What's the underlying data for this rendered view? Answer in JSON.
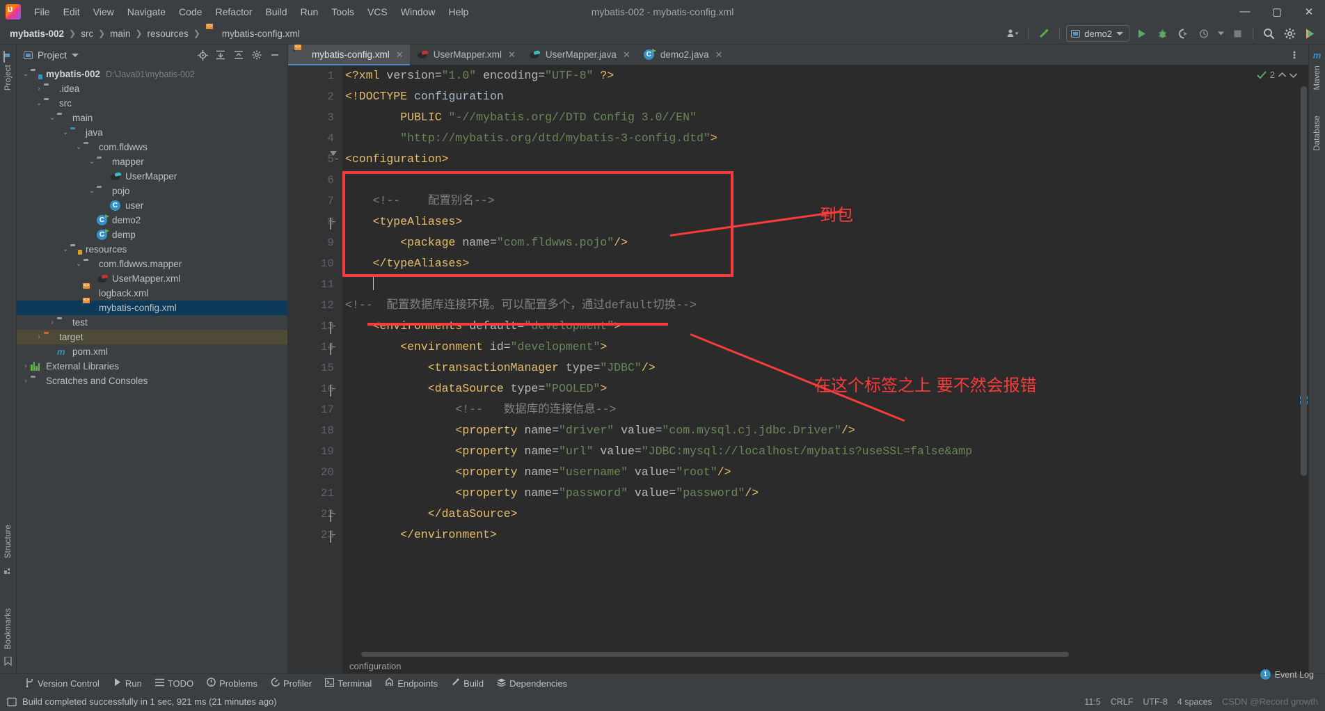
{
  "window": {
    "title": "mybatis-002 - mybatis-config.xml",
    "minimize": "—",
    "maximize": "▢",
    "close": "✕"
  },
  "menu": [
    "File",
    "Edit",
    "View",
    "Navigate",
    "Code",
    "Refactor",
    "Build",
    "Run",
    "Tools",
    "VCS",
    "Window",
    "Help"
  ],
  "breadcrumb": [
    "mybatis-002",
    "src",
    "main",
    "resources",
    "mybatis-config.xml"
  ],
  "toolbar": {
    "run_config": "demo2",
    "icons": [
      "person-dropdown-icon",
      "build-hammer-icon",
      "run-icon",
      "debug-icon",
      "run-with-coverage-icon",
      "profiler-icon",
      "stop-icon",
      "search-everywhere-icon",
      "settings-gear-icon",
      "ide-assistant-icon"
    ]
  },
  "project_panel": {
    "title": "Project",
    "header_icons": [
      "locate-icon",
      "expand-all-icon",
      "collapse-all-icon",
      "settings-gear-icon",
      "hide-icon"
    ],
    "tree": [
      {
        "label": "mybatis-002",
        "path": "D:\\Java01\\mybatis-002",
        "indent": 0,
        "arrow": "v",
        "icon": "module-folder-icon",
        "bold": true
      },
      {
        "label": ".idea",
        "path": "",
        "indent": 1,
        "arrow": ">",
        "icon": "folder-icon",
        "bold": false
      },
      {
        "label": "src",
        "path": "",
        "indent": 1,
        "arrow": "v",
        "icon": "folder-icon",
        "bold": false
      },
      {
        "label": "main",
        "path": "",
        "indent": 2,
        "arrow": "v",
        "icon": "folder-icon",
        "bold": false
      },
      {
        "label": "java",
        "path": "",
        "indent": 3,
        "arrow": "v",
        "icon": "source-folder-icon",
        "bold": false
      },
      {
        "label": "com.fldwws",
        "path": "",
        "indent": 4,
        "arrow": "v",
        "icon": "package-icon",
        "bold": false
      },
      {
        "label": "mapper",
        "path": "",
        "indent": 5,
        "arrow": "v",
        "icon": "package-icon",
        "bold": false
      },
      {
        "label": "UserMapper",
        "path": "",
        "indent": 6,
        "arrow": "",
        "icon": "mybatis-interface-icon",
        "bold": false
      },
      {
        "label": "pojo",
        "path": "",
        "indent": 5,
        "arrow": "v",
        "icon": "package-icon",
        "bold": false
      },
      {
        "label": "user",
        "path": "",
        "indent": 6,
        "arrow": "",
        "icon": "class-icon",
        "bold": false
      },
      {
        "label": "demo2",
        "path": "",
        "indent": 5,
        "arrow": "",
        "icon": "runnable-class-icon",
        "bold": false
      },
      {
        "label": "demp",
        "path": "",
        "indent": 5,
        "arrow": "",
        "icon": "runnable-class-icon",
        "bold": false
      },
      {
        "label": "resources",
        "path": "",
        "indent": 3,
        "arrow": "v",
        "icon": "resource-folder-icon",
        "bold": false
      },
      {
        "label": "com.fldwws.mapper",
        "path": "",
        "indent": 4,
        "arrow": "v",
        "icon": "folder-icon",
        "bold": false
      },
      {
        "label": "UserMapper.xml",
        "path": "",
        "indent": 5,
        "arrow": "",
        "icon": "mybatis-mapper-icon",
        "bold": false
      },
      {
        "label": "logback.xml",
        "path": "",
        "indent": 4,
        "arrow": "",
        "icon": "xml-file-icon",
        "bold": false
      },
      {
        "label": "mybatis-config.xml",
        "path": "",
        "indent": 4,
        "arrow": "",
        "icon": "xml-file-icon",
        "bold": false,
        "selected": true
      },
      {
        "label": "test",
        "path": "",
        "indent": 2,
        "arrow": ">",
        "icon": "folder-icon",
        "bold": false
      },
      {
        "label": "target",
        "path": "",
        "indent": 1,
        "arrow": ">",
        "icon": "excluded-folder-icon",
        "bold": false,
        "highlight": true
      },
      {
        "label": "pom.xml",
        "path": "",
        "indent": 2,
        "arrow": "",
        "icon": "maven-icon",
        "bold": false
      },
      {
        "label": "External Libraries",
        "path": "",
        "indent": 0,
        "arrow": ">",
        "icon": "libraries-icon",
        "bold": false
      },
      {
        "label": "Scratches and Consoles",
        "path": "",
        "indent": 0,
        "arrow": ">",
        "icon": "scratches-icon",
        "bold": false
      }
    ]
  },
  "editor": {
    "tabs": [
      {
        "label": "mybatis-config.xml",
        "icon": "xml-file-icon",
        "active": true
      },
      {
        "label": "UserMapper.xml",
        "icon": "mybatis-mapper-icon",
        "active": false
      },
      {
        "label": "UserMapper.java",
        "icon": "mybatis-interface-icon",
        "active": false
      },
      {
        "label": "demo2.java",
        "icon": "runnable-class-icon",
        "active": false
      }
    ],
    "inspection_count": "2",
    "bottom_breadcrumb": "configuration",
    "line_numbers": [
      "1",
      "2",
      "3",
      "4",
      "5",
      "6",
      "7",
      "8",
      "9",
      "10",
      "11",
      "12",
      "13",
      "14",
      "15",
      "16",
      "17",
      "18",
      "19",
      "20",
      "21",
      "22",
      "23"
    ],
    "lines": [
      {
        "n": 1,
        "segs": [
          {
            "t": "<?xml ",
            "c": "tg"
          },
          {
            "t": "version",
            "c": "at"
          },
          {
            "t": "=",
            "c": "tx"
          },
          {
            "t": "\"1.0\"",
            "c": "st"
          },
          {
            "t": " ",
            "c": "tx"
          },
          {
            "t": "encoding",
            "c": "at"
          },
          {
            "t": "=",
            "c": "tx"
          },
          {
            "t": "\"UTF-8\"",
            "c": "st"
          },
          {
            "t": " ?>",
            "c": "tg"
          }
        ]
      },
      {
        "n": 2,
        "segs": [
          {
            "t": "<!DOCTYPE ",
            "c": "tg"
          },
          {
            "t": "configuration",
            "c": "tx"
          }
        ]
      },
      {
        "n": 3,
        "segs": [
          {
            "t": "        PUBLIC ",
            "c": "tg"
          },
          {
            "t": "\"-//mybatis.org//DTD Config 3.0//EN\"",
            "c": "st"
          }
        ]
      },
      {
        "n": 4,
        "segs": [
          {
            "t": "        ",
            "c": "tx"
          },
          {
            "t": "\"http://mybatis.org/dtd/mybatis-3-config.dtd\"",
            "c": "st"
          },
          {
            "t": ">",
            "c": "tg"
          }
        ]
      },
      {
        "n": 5,
        "segs": [
          {
            "t": "<configuration>",
            "c": "tg"
          }
        ]
      },
      {
        "n": 6,
        "segs": []
      },
      {
        "n": 7,
        "segs": [
          {
            "t": "    <!--    配置别名-->",
            "c": "cm"
          }
        ]
      },
      {
        "n": 8,
        "segs": [
          {
            "t": "    <typeAliases>",
            "c": "tg"
          }
        ]
      },
      {
        "n": 9,
        "segs": [
          {
            "t": "        <package ",
            "c": "tg"
          },
          {
            "t": "name",
            "c": "at"
          },
          {
            "t": "=",
            "c": "tx"
          },
          {
            "t": "\"com.fldwws.pojo\"",
            "c": "st"
          },
          {
            "t": "/>",
            "c": "tg"
          }
        ]
      },
      {
        "n": 10,
        "segs": [
          {
            "t": "    </typeAliases>",
            "c": "tg"
          }
        ]
      },
      {
        "n": 11,
        "segs": [],
        "caret": true
      },
      {
        "n": 12,
        "segs": [
          {
            "t": "<!--  配置数据库连接环境。可以配置多个，通过default切换-->",
            "c": "cm"
          }
        ]
      },
      {
        "n": 13,
        "segs": [
          {
            "t": "    <environments ",
            "c": "tg"
          },
          {
            "t": "default",
            "c": "at"
          },
          {
            "t": "=",
            "c": "tx"
          },
          {
            "t": "\"development\"",
            "c": "st"
          },
          {
            "t": ">",
            "c": "tg"
          }
        ]
      },
      {
        "n": 14,
        "segs": [
          {
            "t": "        <environment ",
            "c": "tg"
          },
          {
            "t": "id",
            "c": "at"
          },
          {
            "t": "=",
            "c": "tx"
          },
          {
            "t": "\"development\"",
            "c": "st"
          },
          {
            "t": ">",
            "c": "tg"
          }
        ]
      },
      {
        "n": 15,
        "segs": [
          {
            "t": "            <transactionManager ",
            "c": "tg"
          },
          {
            "t": "type",
            "c": "at"
          },
          {
            "t": "=",
            "c": "tx"
          },
          {
            "t": "\"JDBC\"",
            "c": "st"
          },
          {
            "t": "/>",
            "c": "tg"
          }
        ]
      },
      {
        "n": 16,
        "segs": [
          {
            "t": "            <dataSource ",
            "c": "tg"
          },
          {
            "t": "type",
            "c": "at"
          },
          {
            "t": "=",
            "c": "tx"
          },
          {
            "t": "\"POOLED\"",
            "c": "st"
          },
          {
            "t": ">",
            "c": "tg"
          }
        ]
      },
      {
        "n": 17,
        "segs": [
          {
            "t": "                <!--   数据库的连接信息-->",
            "c": "cm"
          }
        ]
      },
      {
        "n": 18,
        "segs": [
          {
            "t": "                <property ",
            "c": "tg"
          },
          {
            "t": "name",
            "c": "at"
          },
          {
            "t": "=",
            "c": "tx"
          },
          {
            "t": "\"driver\"",
            "c": "st"
          },
          {
            "t": " ",
            "c": "tx"
          },
          {
            "t": "value",
            "c": "at"
          },
          {
            "t": "=",
            "c": "tx"
          },
          {
            "t": "\"com.mysql.cj.jdbc.Driver\"",
            "c": "st"
          },
          {
            "t": "/>",
            "c": "tg"
          }
        ]
      },
      {
        "n": 19,
        "segs": [
          {
            "t": "                <property ",
            "c": "tg"
          },
          {
            "t": "name",
            "c": "at"
          },
          {
            "t": "=",
            "c": "tx"
          },
          {
            "t": "\"url\"",
            "c": "st"
          },
          {
            "t": " ",
            "c": "tx"
          },
          {
            "t": "value",
            "c": "at"
          },
          {
            "t": "=",
            "c": "tx"
          },
          {
            "t": "\"JDBC:mysql://localhost/mybatis?useSSL=false&amp",
            "c": "st"
          }
        ]
      },
      {
        "n": 20,
        "segs": [
          {
            "t": "                <property ",
            "c": "tg"
          },
          {
            "t": "name",
            "c": "at"
          },
          {
            "t": "=",
            "c": "tx"
          },
          {
            "t": "\"username\"",
            "c": "st"
          },
          {
            "t": " ",
            "c": "tx"
          },
          {
            "t": "value",
            "c": "at"
          },
          {
            "t": "=",
            "c": "tx"
          },
          {
            "t": "\"root\"",
            "c": "st"
          },
          {
            "t": "/>",
            "c": "tg"
          }
        ]
      },
      {
        "n": 21,
        "segs": [
          {
            "t": "                <property ",
            "c": "tg"
          },
          {
            "t": "name",
            "c": "at"
          },
          {
            "t": "=",
            "c": "tx"
          },
          {
            "t": "\"password\"",
            "c": "st"
          },
          {
            "t": " ",
            "c": "tx"
          },
          {
            "t": "value",
            "c": "at"
          },
          {
            "t": "=",
            "c": "tx"
          },
          {
            "t": "\"password\"",
            "c": "st"
          },
          {
            "t": "/>",
            "c": "tg"
          }
        ]
      },
      {
        "n": 22,
        "segs": [
          {
            "t": "            </dataSource>",
            "c": "tg"
          }
        ]
      },
      {
        "n": 23,
        "segs": [
          {
            "t": "        </environment>",
            "c": "tg"
          }
        ]
      }
    ],
    "annotations": [
      {
        "name": "typealiases-highlight-box",
        "text": ""
      },
      {
        "name": "to-package-label",
        "text": "到包"
      },
      {
        "name": "must-be-above-tag-label",
        "text": "在这个标签之上 要不然会报错"
      }
    ]
  },
  "left_rail": [
    "Project",
    "Structure",
    "Bookmarks"
  ],
  "right_rail": [
    "m",
    "Maven",
    "Database"
  ],
  "bottom_toolwindows": [
    {
      "label": "Version Control",
      "icon": "branch-icon"
    },
    {
      "label": "Run",
      "icon": "run-icon"
    },
    {
      "label": "TODO",
      "icon": "todo-list-icon"
    },
    {
      "label": "Problems",
      "icon": "problems-icon"
    },
    {
      "label": "Profiler",
      "icon": "profiler-icon"
    },
    {
      "label": "Terminal",
      "icon": "terminal-icon"
    },
    {
      "label": "Endpoints",
      "icon": "endpoints-icon"
    },
    {
      "label": "Build",
      "icon": "build-hammer-icon"
    },
    {
      "label": "Dependencies",
      "icon": "dependencies-icon"
    }
  ],
  "status_bar": {
    "message": "Build completed successfully in 1 sec, 921 ms (21 minutes ago)",
    "caret_position": "11:5",
    "line_separator": "CRLF",
    "encoding": "UTF-8",
    "indent": "4 spaces",
    "event_log": "Event Log",
    "event_count": "1",
    "watermark": "CSDN @Record growth"
  },
  "colors": {
    "accent_blue": "#4a88c7",
    "annotation_red": "#f83b3b",
    "selection_blue": "#0d3a58",
    "string_green": "#6a8759",
    "tag_orange": "#e8bf6a",
    "editor_bg": "#2b2b2b",
    "chrome_bg": "#3c3f41"
  }
}
